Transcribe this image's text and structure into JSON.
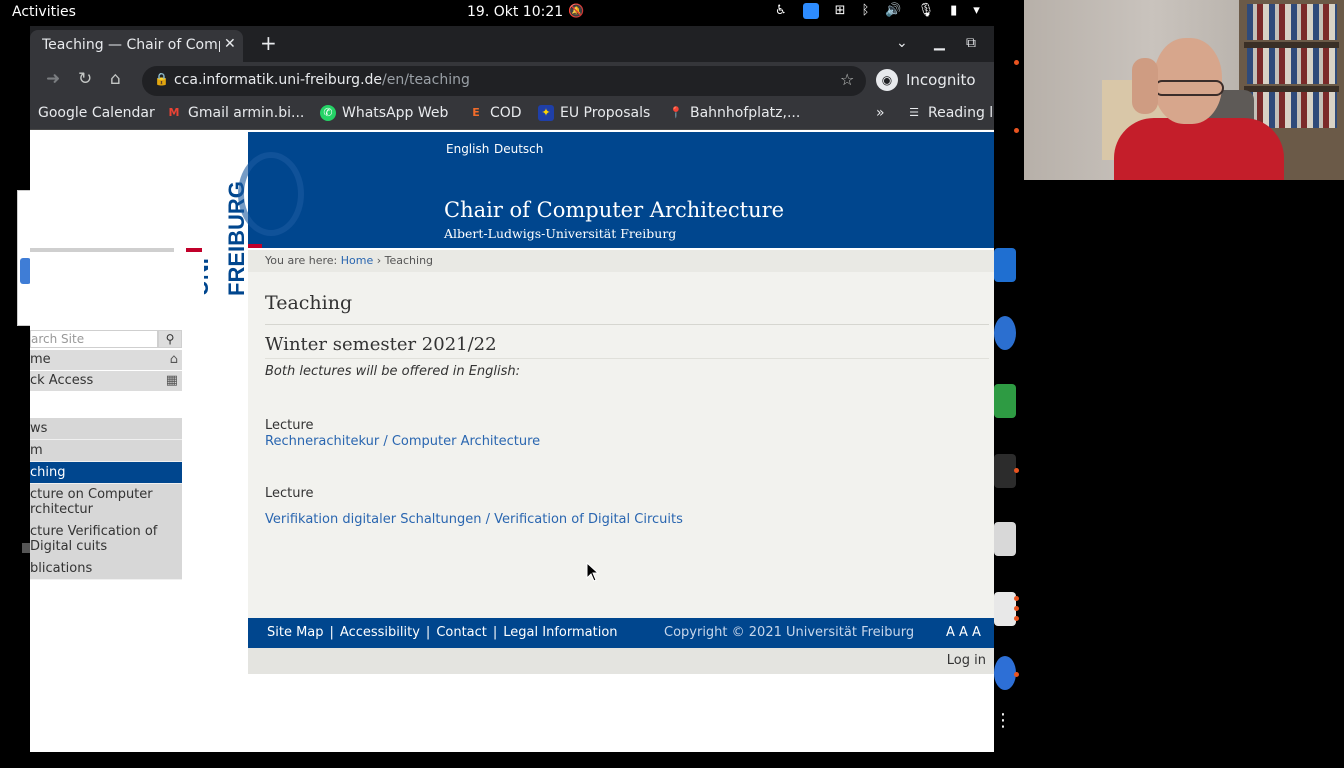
{
  "topbar": {
    "activities": "Activities",
    "clock": "19. Okt  10:21"
  },
  "browser": {
    "tab_title": "Teaching — Chair of Computer Architecture",
    "url_host": "cca.informatik.uni-freiburg.de",
    "url_path": "/en/teaching",
    "incognito": "Incognito",
    "bookmarks": [
      {
        "label": "Google Calendar"
      },
      {
        "label": "Gmail armin.bi..."
      },
      {
        "label": "WhatsApp Web"
      },
      {
        "label": "COD"
      },
      {
        "label": "EU Proposals"
      },
      {
        "label": "Bahnhofplatz,..."
      },
      {
        "label": "Reading l"
      }
    ]
  },
  "site": {
    "lang_en": "English",
    "lang_de": "Deutsch",
    "title": "Chair of Computer Architecture",
    "subtitle": "Albert-Ludwigs-Universität Freiburg",
    "logo_uni": "UNI",
    "logo_freiburg": "FREIBURG",
    "search_placeholder": "arch Site",
    "home": "me",
    "quick_access": "ck Access",
    "nav": [
      {
        "label": "ws"
      },
      {
        "label": "m"
      },
      {
        "label": "ching"
      },
      {
        "label": "cture on Computer rchitectur"
      },
      {
        "label": "cture Verification of Digital cuits"
      },
      {
        "label": "blications"
      }
    ]
  },
  "breadcrumb": {
    "prefix": "You are here:",
    "home": "Home",
    "sep": "›",
    "current": "Teaching"
  },
  "content": {
    "page_title": "Teaching",
    "semester": "Winter semester 2021/22",
    "intro": "Both lectures will be offered in English:",
    "lecture1_label": "Lecture",
    "lecture1_link": "Rechnerachitekur / Computer Architecture",
    "lecture2_label": "Lecture",
    "lecture2_link": "Verifikation digitaler Schaltungen / Verification of Digital Circuits"
  },
  "footer": {
    "site_map": "Site Map",
    "accessibility": "Accessibility",
    "contact": "Contact",
    "legal": "Legal Information",
    "pipe": "|",
    "copyright": "Copyright © 2021 Universität Freiburg",
    "font_sizes": "A A A",
    "login": "Log in"
  }
}
